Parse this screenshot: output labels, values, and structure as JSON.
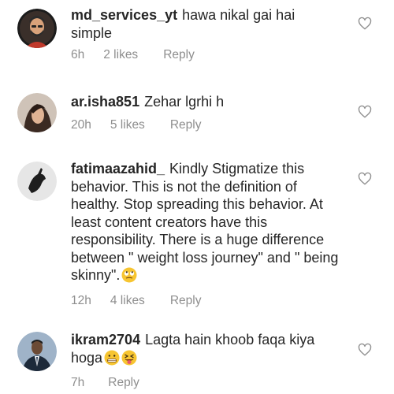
{
  "comments": [
    {
      "username": "md_services_yt",
      "text": "hawa nikal gai hai simple",
      "time": "6h",
      "likes": "2 likes",
      "reply": "Reply",
      "avatar_icon": "cartoon-man-avatar-icon"
    },
    {
      "username": "ar.isha851",
      "text": "Zehar lgrhi h",
      "time": "20h",
      "likes": "5 likes",
      "reply": "Reply",
      "avatar_icon": "woman-photo-avatar-icon"
    },
    {
      "username": "fatimaazahid_",
      "text": "Kindly Stigmatize this behavior. This is not the definition of healthy. Stop spreading this behavior. At least content creators have this responsibility.  There is a huge difference between \" weight loss journey\" and \" being skinny\".",
      "emoji": "face-with-rolling-eyes-emoji",
      "time": "12h",
      "likes": "4 likes",
      "reply": "Reply",
      "avatar_icon": "hand-silhouette-avatar-icon"
    },
    {
      "username": "ikram2704",
      "text": "Lagta hain khoob faqa kiya hoga",
      "emoji": "grimacing-face-and-squinting-tongue-emoji",
      "time": "7h",
      "reply": "Reply",
      "avatar_icon": "man-in-suit-avatar-icon"
    }
  ],
  "icons": {
    "like": "heart-outline-icon"
  },
  "colors": {
    "text": "#262626",
    "meta": "#8e8e8e"
  }
}
